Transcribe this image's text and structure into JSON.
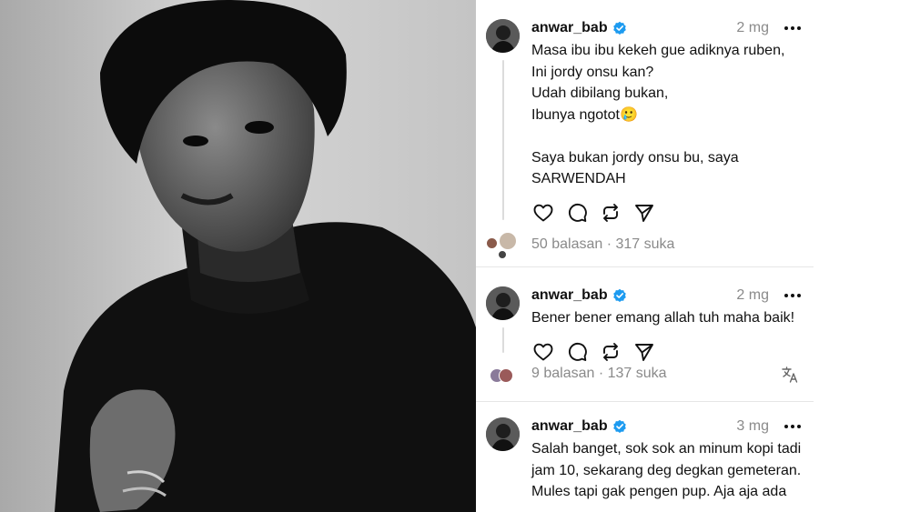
{
  "photo": {
    "alt_icon": "portrait-photo"
  },
  "posts": [
    {
      "username": "anwar_bab",
      "time": "2 mg",
      "lines": [
        "Masa ibu ibu kekeh gue adiknya ruben,",
        "Ini jordy onsu kan?",
        "Udah dibilang bukan,",
        "Ibunya ngotot🥲",
        "",
        "Saya bukan jordy onsu bu, saya",
        "SARWENDAH"
      ],
      "stats": "50 balasan · 317 suka"
    },
    {
      "username": "anwar_bab",
      "time": "2 mg",
      "lines": [
        "Bener bener emang allah tuh maha baik!"
      ],
      "stats": "9 balasan · 137 suka"
    },
    {
      "username": "anwar_bab",
      "time": "3 mg",
      "lines": [
        "Salah banget, sok sok an minum kopi tadi",
        "jam 10, sekarang deg degkan gemeteran.",
        "Mules tapi gak pengen pup. Aja aja ada"
      ]
    }
  ],
  "icons": {
    "like": "heart-icon",
    "reply": "comment-icon",
    "repost": "repost-icon",
    "share": "send-icon",
    "verified": "verified-badge-icon",
    "more": "more-icon",
    "translate": "translate-icon"
  },
  "colors": {
    "verified": "#1d9bf0",
    "muted": "#8a8a8a",
    "divider": "#e6e6e6"
  }
}
